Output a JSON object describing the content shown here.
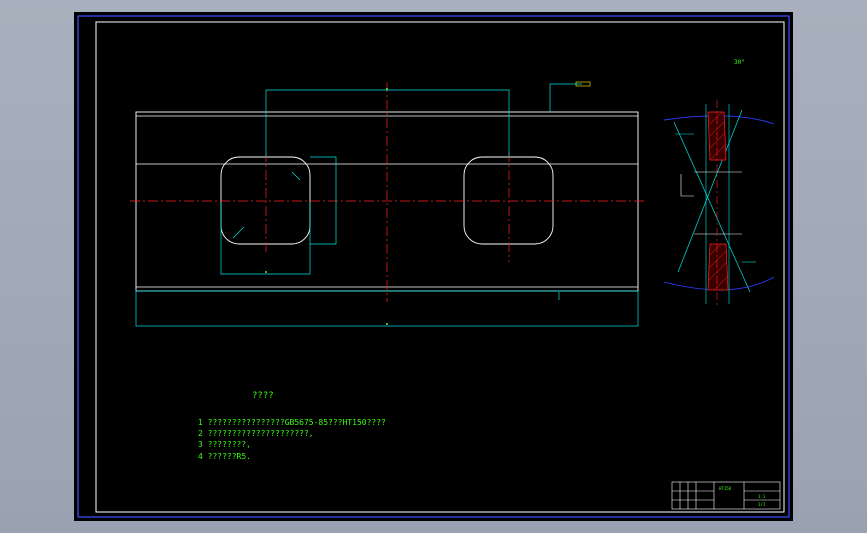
{
  "drawing": {
    "notes_heading": "????",
    "notes": [
      "1 ????????????????GB5675-85???HT150????",
      "2 ?????????????????????,",
      "3 ????????,",
      "4 ??????R5."
    ],
    "angle_label": "30°",
    "title_block": {
      "material": "HT150",
      "scale": "1:1",
      "sheet": "1/1"
    }
  },
  "colors": {
    "outline": "#ffffff",
    "centerline": "#ff2020",
    "dimension": "#00e5e5",
    "text": "#39ff14",
    "frame": "#3b52ff",
    "hatch": "#ff2020",
    "arc": "#2e3cff"
  }
}
